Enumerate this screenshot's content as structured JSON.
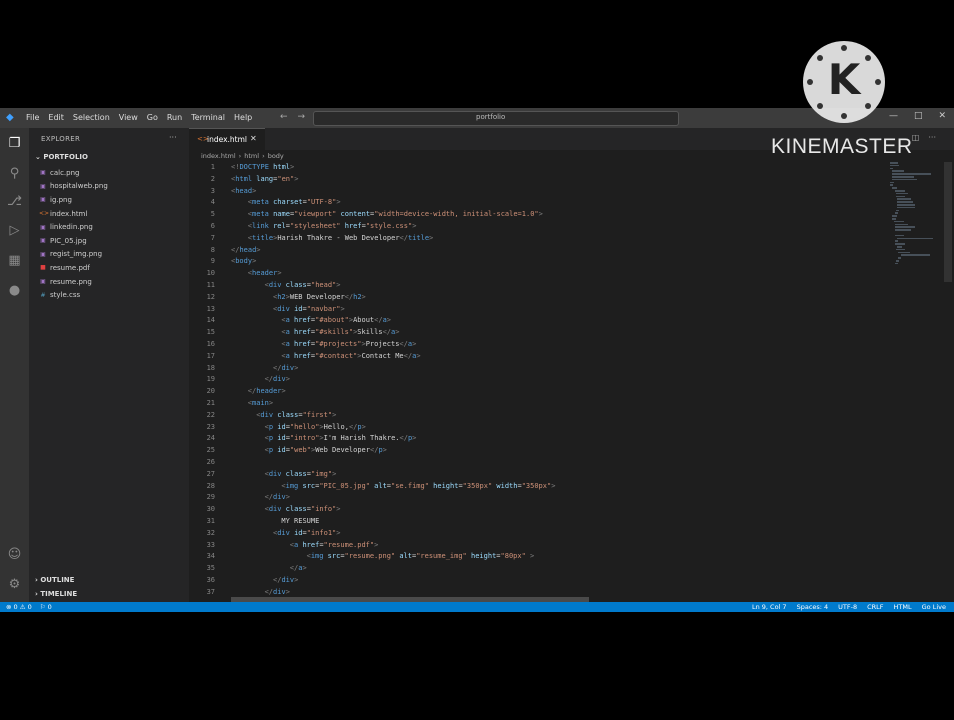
{
  "titlebar": {
    "menu": [
      "File",
      "Edit",
      "Selection",
      "View",
      "Go",
      "Run",
      "Terminal",
      "Help"
    ],
    "search_text": "portfolio"
  },
  "sidebar": {
    "title": "EXPLORER",
    "more": "···",
    "folder": "PORTFOLIO",
    "files": [
      {
        "name": "calc.png",
        "icon": "image-icon"
      },
      {
        "name": "hospitalweb.png",
        "icon": "image-icon"
      },
      {
        "name": "ig.png",
        "icon": "image-icon"
      },
      {
        "name": "index.html",
        "icon": "html-icon"
      },
      {
        "name": "linkedin.png",
        "icon": "image-icon"
      },
      {
        "name": "PIC_05.jpg",
        "icon": "image-icon"
      },
      {
        "name": "regist_img.png",
        "icon": "image-icon"
      },
      {
        "name": "resume.pdf",
        "icon": "pdf-icon"
      },
      {
        "name": "resume.png",
        "icon": "image-icon"
      },
      {
        "name": "style.css",
        "icon": "css-icon"
      }
    ],
    "outline": "OUTLINE",
    "timeline": "TIMELINE"
  },
  "editor": {
    "tab_name": "index.html",
    "breadcrumb": [
      "index.html",
      "html",
      "body"
    ],
    "lines": [
      {
        "n": "1",
        "indent": 0,
        "parts": [
          [
            "g",
            "<!"
          ],
          [
            "t",
            "DOCTYPE"
          ],
          [
            "a",
            " html"
          ],
          [
            "g",
            ">"
          ]
        ]
      },
      {
        "n": "2",
        "indent": 0,
        "parts": [
          [
            "g",
            "<"
          ],
          [
            "t",
            "html"
          ],
          [
            "a",
            " lang"
          ],
          [
            "x",
            "="
          ],
          [
            "s",
            "\"en\""
          ],
          [
            "g",
            ">"
          ]
        ]
      },
      {
        "n": "3",
        "indent": 0,
        "parts": [
          [
            "g",
            "<"
          ],
          [
            "t",
            "head"
          ],
          [
            "g",
            ">"
          ]
        ]
      },
      {
        "n": "4",
        "indent": 2,
        "parts": [
          [
            "g",
            "<"
          ],
          [
            "t",
            "meta"
          ],
          [
            "a",
            " charset"
          ],
          [
            "x",
            "="
          ],
          [
            "s",
            "\"UTF-8\""
          ],
          [
            "g",
            ">"
          ]
        ]
      },
      {
        "n": "5",
        "indent": 2,
        "parts": [
          [
            "g",
            "<"
          ],
          [
            "t",
            "meta"
          ],
          [
            "a",
            " name"
          ],
          [
            "x",
            "="
          ],
          [
            "s",
            "\"viewport\""
          ],
          [
            "a",
            " content"
          ],
          [
            "x",
            "="
          ],
          [
            "s",
            "\"width=device-width, initial-scale=1.0\""
          ],
          [
            "g",
            ">"
          ]
        ]
      },
      {
        "n": "6",
        "indent": 2,
        "parts": [
          [
            "g",
            "<"
          ],
          [
            "t",
            "link"
          ],
          [
            "a",
            " rel"
          ],
          [
            "x",
            "="
          ],
          [
            "s",
            "\"stylesheet\""
          ],
          [
            "a",
            " href"
          ],
          [
            "x",
            "="
          ],
          [
            "s",
            "\"style.css\""
          ],
          [
            "g",
            ">"
          ]
        ]
      },
      {
        "n": "7",
        "indent": 2,
        "parts": [
          [
            "g",
            "<"
          ],
          [
            "t",
            "title"
          ],
          [
            "g",
            ">"
          ],
          [
            "x",
            "Harish Thakre - Web Developer"
          ],
          [
            "g",
            "</"
          ],
          [
            "t",
            "title"
          ],
          [
            "g",
            ">"
          ]
        ]
      },
      {
        "n": "8",
        "indent": 0,
        "parts": [
          [
            "g",
            "</"
          ],
          [
            "t",
            "head"
          ],
          [
            "g",
            ">"
          ]
        ]
      },
      {
        "n": "9",
        "indent": 0,
        "parts": [
          [
            "g",
            "<"
          ],
          [
            "t",
            "body"
          ],
          [
            "g",
            ">"
          ]
        ]
      },
      {
        "n": "10",
        "indent": 2,
        "parts": [
          [
            "g",
            "<"
          ],
          [
            "t",
            "header"
          ],
          [
            "g",
            ">"
          ]
        ]
      },
      {
        "n": "11",
        "indent": 4,
        "parts": [
          [
            "g",
            "<"
          ],
          [
            "t",
            "div"
          ],
          [
            "a",
            " class"
          ],
          [
            "x",
            "="
          ],
          [
            "s",
            "\"head\""
          ],
          [
            "g",
            ">"
          ]
        ]
      },
      {
        "n": "12",
        "indent": 5,
        "parts": [
          [
            "g",
            "<"
          ],
          [
            "t",
            "h2"
          ],
          [
            "g",
            ">"
          ],
          [
            "x",
            "WEB Developer"
          ],
          [
            "g",
            "</"
          ],
          [
            "t",
            "h2"
          ],
          [
            "g",
            ">"
          ]
        ]
      },
      {
        "n": "13",
        "indent": 5,
        "parts": [
          [
            "g",
            "<"
          ],
          [
            "t",
            "div"
          ],
          [
            "a",
            " id"
          ],
          [
            "x",
            "="
          ],
          [
            "s",
            "\"navbar\""
          ],
          [
            "g",
            ">"
          ]
        ]
      },
      {
        "n": "14",
        "indent": 6,
        "parts": [
          [
            "g",
            "<"
          ],
          [
            "t",
            "a"
          ],
          [
            "a",
            " href"
          ],
          [
            "x",
            "="
          ],
          [
            "s",
            "\"#about\""
          ],
          [
            "g",
            ">"
          ],
          [
            "x",
            "About"
          ],
          [
            "g",
            "</"
          ],
          [
            "t",
            "a"
          ],
          [
            "g",
            ">"
          ]
        ]
      },
      {
        "n": "15",
        "indent": 6,
        "parts": [
          [
            "g",
            "<"
          ],
          [
            "t",
            "a"
          ],
          [
            "a",
            " href"
          ],
          [
            "x",
            "="
          ],
          [
            "s",
            "\"#skills\""
          ],
          [
            "g",
            ">"
          ],
          [
            "x",
            "Skills"
          ],
          [
            "g",
            "</"
          ],
          [
            "t",
            "a"
          ],
          [
            "g",
            ">"
          ]
        ]
      },
      {
        "n": "16",
        "indent": 6,
        "parts": [
          [
            "g",
            "<"
          ],
          [
            "t",
            "a"
          ],
          [
            "a",
            " href"
          ],
          [
            "x",
            "="
          ],
          [
            "s",
            "\"#projects\""
          ],
          [
            "g",
            ">"
          ],
          [
            "x",
            "Projects"
          ],
          [
            "g",
            "</"
          ],
          [
            "t",
            "a"
          ],
          [
            "g",
            ">"
          ]
        ]
      },
      {
        "n": "17",
        "indent": 6,
        "parts": [
          [
            "g",
            "<"
          ],
          [
            "t",
            "a"
          ],
          [
            "a",
            " href"
          ],
          [
            "x",
            "="
          ],
          [
            "s",
            "\"#contact\""
          ],
          [
            "g",
            ">"
          ],
          [
            "x",
            "Contact Me"
          ],
          [
            "g",
            "</"
          ],
          [
            "t",
            "a"
          ],
          [
            "g",
            ">"
          ]
        ]
      },
      {
        "n": "18",
        "indent": 5,
        "parts": [
          [
            "g",
            "</"
          ],
          [
            "t",
            "div"
          ],
          [
            "g",
            ">"
          ]
        ]
      },
      {
        "n": "19",
        "indent": 4,
        "parts": [
          [
            "g",
            "</"
          ],
          [
            "t",
            "div"
          ],
          [
            "g",
            ">"
          ]
        ]
      },
      {
        "n": "20",
        "indent": 2,
        "parts": [
          [
            "g",
            "</"
          ],
          [
            "t",
            "header"
          ],
          [
            "g",
            ">"
          ]
        ]
      },
      {
        "n": "21",
        "indent": 2,
        "parts": [
          [
            "g",
            "<"
          ],
          [
            "t",
            "main"
          ],
          [
            "g",
            ">"
          ]
        ]
      },
      {
        "n": "22",
        "indent": 3,
        "parts": [
          [
            "g",
            "<"
          ],
          [
            "t",
            "div"
          ],
          [
            "a",
            " class"
          ],
          [
            "x",
            "="
          ],
          [
            "s",
            "\"first\""
          ],
          [
            "g",
            ">"
          ]
        ]
      },
      {
        "n": "23",
        "indent": 4,
        "parts": [
          [
            "g",
            "<"
          ],
          [
            "t",
            "p"
          ],
          [
            "a",
            " id"
          ],
          [
            "x",
            "="
          ],
          [
            "s",
            "\"hello\""
          ],
          [
            "g",
            ">"
          ],
          [
            "x",
            "Hello,"
          ],
          [
            "g",
            "</"
          ],
          [
            "t",
            "p"
          ],
          [
            "g",
            ">"
          ]
        ]
      },
      {
        "n": "24",
        "indent": 4,
        "parts": [
          [
            "g",
            "<"
          ],
          [
            "t",
            "p"
          ],
          [
            "a",
            " id"
          ],
          [
            "x",
            "="
          ],
          [
            "s",
            "\"intro\""
          ],
          [
            "g",
            ">"
          ],
          [
            "x",
            "I'm Harish Thakre."
          ],
          [
            "g",
            "</"
          ],
          [
            "t",
            "p"
          ],
          [
            "g",
            ">"
          ]
        ]
      },
      {
        "n": "25",
        "indent": 4,
        "parts": [
          [
            "g",
            "<"
          ],
          [
            "t",
            "p"
          ],
          [
            "a",
            " id"
          ],
          [
            "x",
            "="
          ],
          [
            "s",
            "\"web\""
          ],
          [
            "g",
            ">"
          ],
          [
            "x",
            "Web Developer"
          ],
          [
            "g",
            "</"
          ],
          [
            "t",
            "p"
          ],
          [
            "g",
            ">"
          ]
        ]
      },
      {
        "n": "26",
        "indent": 0,
        "parts": []
      },
      {
        "n": "27",
        "indent": 4,
        "parts": [
          [
            "g",
            "<"
          ],
          [
            "t",
            "div"
          ],
          [
            "a",
            " class"
          ],
          [
            "x",
            "="
          ],
          [
            "s",
            "\"img\""
          ],
          [
            "g",
            ">"
          ]
        ]
      },
      {
        "n": "28",
        "indent": 6,
        "parts": [
          [
            "g",
            "<"
          ],
          [
            "t",
            "img"
          ],
          [
            "a",
            " src"
          ],
          [
            "x",
            "="
          ],
          [
            "s",
            "\"PIC_05.jpg\""
          ],
          [
            "a",
            " alt"
          ],
          [
            "x",
            "="
          ],
          [
            "s",
            "\"se.fimg\""
          ],
          [
            "a",
            " height"
          ],
          [
            "x",
            "="
          ],
          [
            "s",
            "\"350px\""
          ],
          [
            "a",
            " width"
          ],
          [
            "x",
            "="
          ],
          [
            "s",
            "\"350px\""
          ],
          [
            "g",
            ">"
          ]
        ]
      },
      {
        "n": "29",
        "indent": 4,
        "parts": [
          [
            "g",
            "</"
          ],
          [
            "t",
            "div"
          ],
          [
            "g",
            ">"
          ]
        ]
      },
      {
        "n": "30",
        "indent": 4,
        "parts": [
          [
            "g",
            "<"
          ],
          [
            "t",
            "div"
          ],
          [
            "a",
            " class"
          ],
          [
            "x",
            "="
          ],
          [
            "s",
            "\"info\""
          ],
          [
            "g",
            ">"
          ]
        ]
      },
      {
        "n": "31",
        "indent": 6,
        "parts": [
          [
            "x",
            "MY RESUME"
          ]
        ]
      },
      {
        "n": "32",
        "indent": 5,
        "parts": [
          [
            "g",
            "<"
          ],
          [
            "t",
            "div"
          ],
          [
            "a",
            " id"
          ],
          [
            "x",
            "="
          ],
          [
            "s",
            "\"info1\""
          ],
          [
            "g",
            ">"
          ]
        ]
      },
      {
        "n": "33",
        "indent": 7,
        "parts": [
          [
            "g",
            "<"
          ],
          [
            "t",
            "a"
          ],
          [
            "a",
            " href"
          ],
          [
            "x",
            "="
          ],
          [
            "s",
            "\"resume.pdf\""
          ],
          [
            "g",
            ">"
          ]
        ]
      },
      {
        "n": "34",
        "indent": 9,
        "parts": [
          [
            "g",
            "<"
          ],
          [
            "t",
            "img"
          ],
          [
            "a",
            " src"
          ],
          [
            "x",
            "="
          ],
          [
            "s",
            "\"resume.png\""
          ],
          [
            "a",
            " alt"
          ],
          [
            "x",
            "="
          ],
          [
            "s",
            "\"resume_img\""
          ],
          [
            "a",
            " height"
          ],
          [
            "x",
            "="
          ],
          [
            "s",
            "\"80px\""
          ],
          [
            "g",
            " >"
          ]
        ]
      },
      {
        "n": "35",
        "indent": 7,
        "parts": [
          [
            "g",
            "</"
          ],
          [
            "t",
            "a"
          ],
          [
            "g",
            ">"
          ]
        ]
      },
      {
        "n": "36",
        "indent": 5,
        "parts": [
          [
            "g",
            "</"
          ],
          [
            "t",
            "div"
          ],
          [
            "g",
            ">"
          ]
        ]
      },
      {
        "n": "37",
        "indent": 4,
        "parts": [
          [
            "g",
            "</"
          ],
          [
            "t",
            "div"
          ],
          [
            "g",
            ">"
          ]
        ]
      }
    ]
  },
  "statusbar": {
    "left": [
      "⊗ 0 ⚠ 0",
      "⚐ 0"
    ],
    "right": [
      "Ln 9, Col 7",
      "Spaces: 4",
      "UTF-8",
      "CRLF",
      "HTML",
      "Go Live"
    ]
  },
  "watermark": {
    "letter": "K",
    "text": "KINEMASTER"
  },
  "colors": {
    "editor_bg": "#1e1e1e",
    "statusbar": "#007acc",
    "tag": "#569cd6",
    "attr": "#9cdcfe",
    "string": "#ce9178"
  }
}
